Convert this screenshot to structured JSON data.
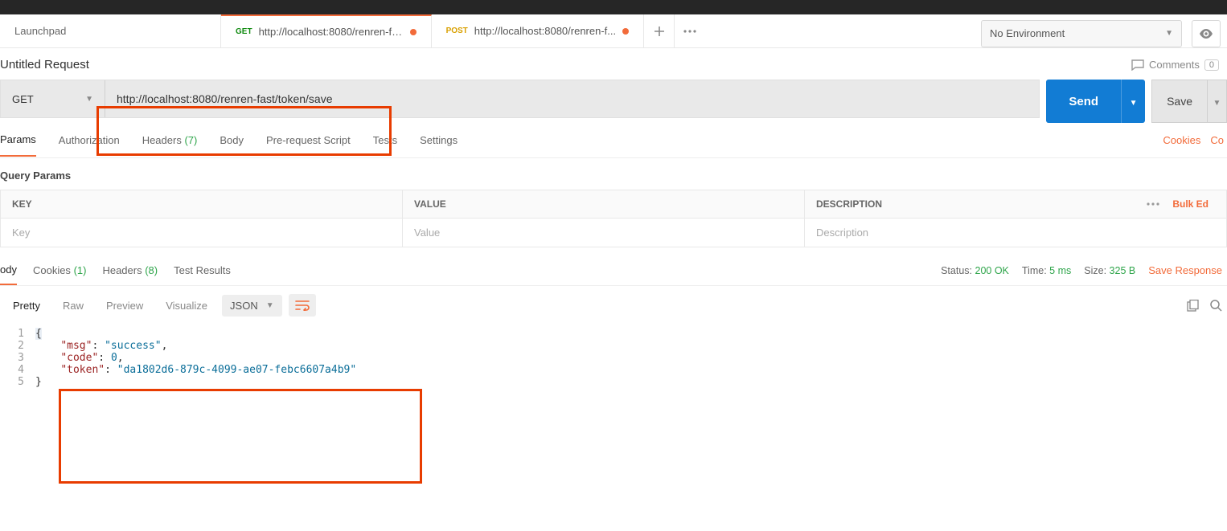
{
  "tabs": {
    "launchpad": "Launchpad",
    "t1_method": "GET",
    "t1_title": "http://localhost:8080/renren-fa...",
    "t2_method": "POST",
    "t2_title": "http://localhost:8080/renren-f..."
  },
  "env": {
    "label": "No Environment"
  },
  "request": {
    "title": "Untitled Request",
    "comments_label": "Comments",
    "comments_count": "0",
    "method": "GET",
    "url": "http://localhost:8080/renren-fast/token/save",
    "send": "Send",
    "save": "Save"
  },
  "req_tabs": {
    "params": "Params",
    "auth": "Authorization",
    "headers": "Headers",
    "headers_count": "(7)",
    "body": "Body",
    "prereq": "Pre-request Script",
    "tests": "Tests",
    "settings": "Settings",
    "cookies": "Cookies",
    "code": "Co"
  },
  "params": {
    "section": "Query Params",
    "key_hdr": "KEY",
    "value_hdr": "VALUE",
    "desc_hdr": "DESCRIPTION",
    "bulk": "Bulk Ed",
    "key_ph": "Key",
    "value_ph": "Value",
    "desc_ph": "Description"
  },
  "resp_tabs": {
    "body": "ody",
    "cookies": "Cookies",
    "cookies_count": "(1)",
    "headers": "Headers",
    "headers_count": "(8)",
    "tests": "Test Results"
  },
  "resp_meta": {
    "status_label": "Status:",
    "status_val": "200 OK",
    "time_label": "Time:",
    "time_val": "5 ms",
    "size_label": "Size:",
    "size_val": "325 B",
    "save_response": "Save Response"
  },
  "viewer": {
    "pretty": "Pretty",
    "raw": "Raw",
    "preview": "Preview",
    "visualize": "Visualize",
    "format": "JSON"
  },
  "response_body": {
    "msg_key": "\"msg\"",
    "msg_val": "\"success\"",
    "code_key": "\"code\"",
    "code_val": "0",
    "token_key": "\"token\"",
    "token_val": "\"da1802d6-879c-4099-ae07-febc6607a4b9\""
  },
  "linenos": {
    "l1": "1",
    "l2": "2",
    "l3": "3",
    "l4": "4",
    "l5": "5"
  }
}
